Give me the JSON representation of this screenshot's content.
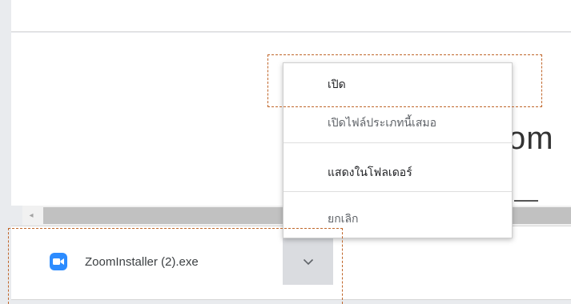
{
  "background": {
    "heading_fragment": "om",
    "scroll_left_arrow": "◂"
  },
  "download": {
    "file_name": "ZoomInstaller (2).exe",
    "icon": "zoom-app-icon",
    "chevron_icon": "chevron-down-icon"
  },
  "context_menu": {
    "items": [
      {
        "label": "เปิด"
      },
      {
        "label": "เปิดไฟล์ประเภทนี้เสมอ"
      },
      {
        "label": "แสดงในโฟลเดอร์"
      },
      {
        "label": "ยกเลิก"
      }
    ]
  },
  "colors": {
    "zoom_blue": "#2d8cff",
    "highlight_border": "#c0662a",
    "chevron_button_bg": "#dadce0"
  }
}
